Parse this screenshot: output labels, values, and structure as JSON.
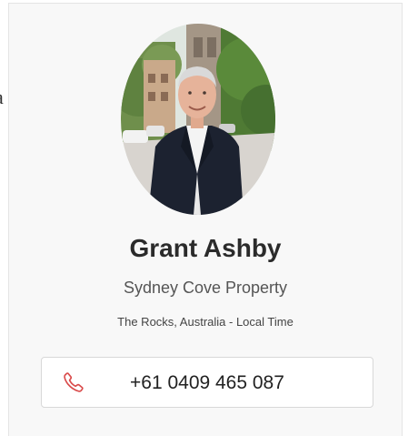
{
  "partial_text": {
    "left_edge_fragment": "a"
  },
  "agent": {
    "photo_icon": "agent-portrait",
    "name": "Grant Ashby",
    "company": "Sydney Cove Property",
    "location": "The Rocks, Australia - Local Time"
  },
  "contact": {
    "phone_icon": "phone-icon",
    "phone_number": "+61 0409 465 087"
  },
  "colors": {
    "card_background": "#f8f8f8",
    "accent": "#d94a4a",
    "name_text": "#2b2b2b"
  }
}
